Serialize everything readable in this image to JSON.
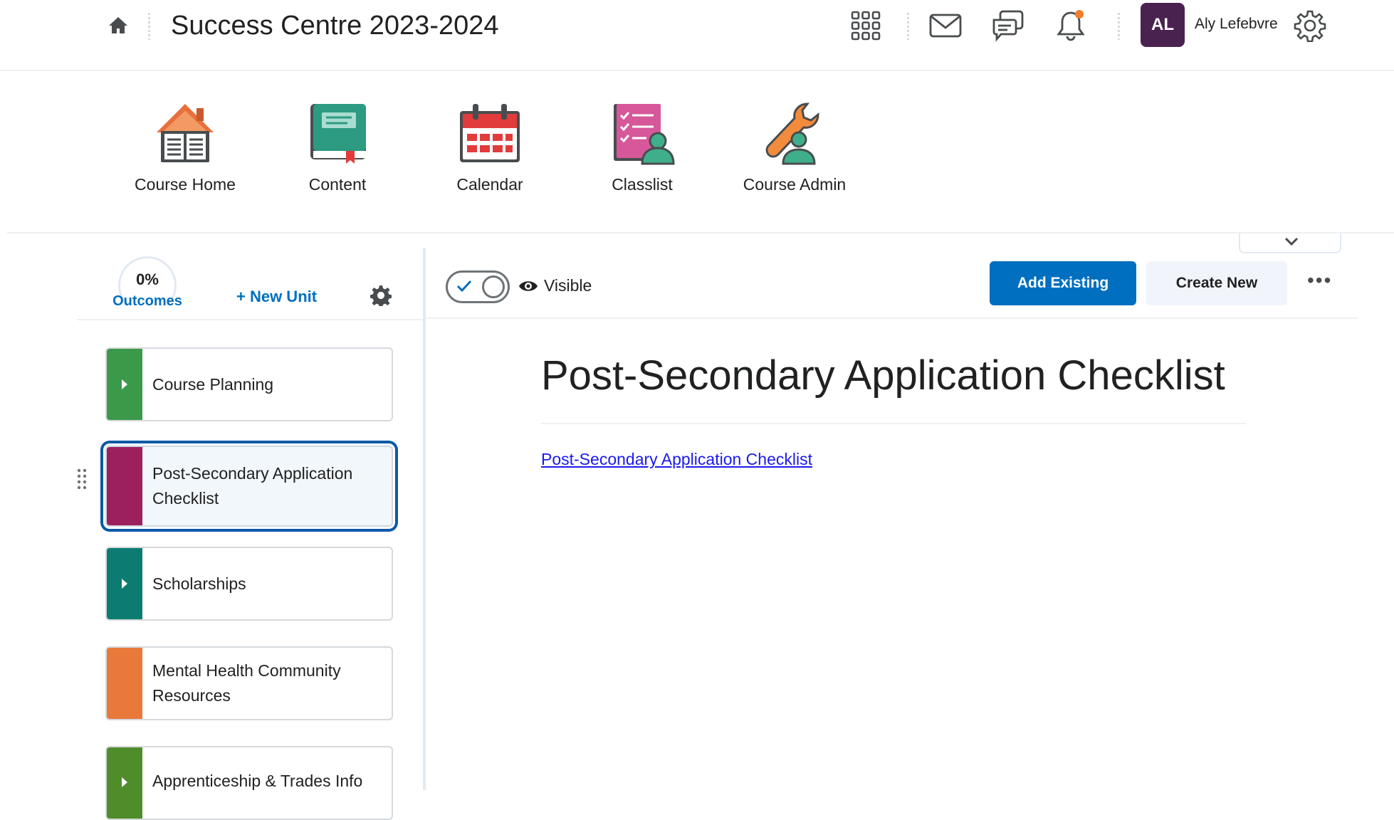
{
  "header": {
    "course_title": "Success Centre 2023-2024",
    "icons": [
      "home-icon",
      "waffle-icon",
      "mail-icon",
      "chat-icon",
      "bell-icon",
      "gear-icon"
    ],
    "user": {
      "initials": "AL",
      "name": "Aly Lefebvre",
      "avatar_color": "#4a2250"
    },
    "notification_dot_color": "#f07e2a"
  },
  "navbar": {
    "items": [
      {
        "label": "Course Home",
        "icon": "course-home-icon"
      },
      {
        "label": "Content",
        "icon": "content-book-icon"
      },
      {
        "label": "Calendar",
        "icon": "calendar-icon"
      },
      {
        "label": "Classlist",
        "icon": "classlist-icon"
      },
      {
        "label": "Course Admin",
        "icon": "course-admin-icon"
      }
    ]
  },
  "left_panel": {
    "outcomes_percent": "0%",
    "outcomes_label": "Outcomes",
    "new_unit_label": "+ New Unit",
    "units": [
      {
        "label": "Course Planning",
        "color": "#3b9a4a",
        "has_children": true
      },
      {
        "label": "Post-Secondary Application Checklist",
        "color": "#9c1f5e",
        "has_children": false,
        "selected": true
      },
      {
        "label": "Scholarships",
        "color": "#0c7c72",
        "has_children": true
      },
      {
        "label": "Mental Health Community Resources",
        "color": "#e8793b",
        "has_children": false
      },
      {
        "label": "Apprenticeship & Trades Info",
        "color": "#4f8d2b",
        "has_children": true
      }
    ]
  },
  "main": {
    "visible_label": "Visible",
    "visible_toggle_on": true,
    "add_existing_label": "Add Existing",
    "create_new_label": "Create New",
    "more_label": "•••",
    "page_title": "Post-Secondary Application Checklist",
    "link_text": "Post-Secondary Application Checklist",
    "primary_color": "#006fbf"
  }
}
